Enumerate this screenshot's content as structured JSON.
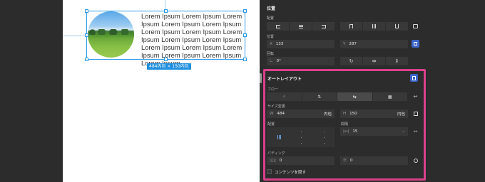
{
  "canvas": {
    "lorem_text": "Lorem Ipsum Lorem Ipsum Lorem Ipsum Lorem Ipsum Lorem Ipsum Lorem Ipsum Lorem Ipsum Lorem Ipsum Lorem Ipsum Lorem Ipsum Lorem Ipsum Lorem Ipsum Lorem Ipsum Lorem Ipsum Lorem Ipsum Lorem Ipsum",
    "size_badge": "484内包 × 150内包"
  },
  "panel": {
    "position_section_title": "位置",
    "alignment_label": "配置",
    "position_label": "位置",
    "x_label": "X",
    "x_value": "133",
    "y_label": "Y",
    "y_value": "287",
    "rotation_label": "回転",
    "rotation_value": "0°"
  },
  "autolayout": {
    "title": "オートレイアウト",
    "flow_label": "フロー",
    "resize_label": "サイズ変更",
    "width_label": "W",
    "width_value": "484",
    "width_mode": "内包",
    "height_label": "H",
    "height_value": "150",
    "height_mode": "内包",
    "alignment_label": "配置",
    "gap_label": "間隔",
    "gap_value": "15",
    "padding_label": "パディング",
    "padding_h_value": "0",
    "padding_v_value": "0",
    "clip_content_label": "コンテンツを隠す"
  },
  "colors": {
    "selection": "#2f9be8",
    "highlight_border": "#d9418b",
    "active_toggle": "#3c64c8",
    "panel_bg": "#2c2c2c"
  },
  "icons": [
    "align-left-icon",
    "align-center-h-icon",
    "align-right-icon",
    "align-top-icon",
    "align-center-v-icon",
    "align-bottom-icon",
    "distribute-icon",
    "flip-rotate-icon",
    "flip-horizontal-icon",
    "flip-vertical-icon",
    "autolayout-icon",
    "flow-none-icon",
    "flow-vertical-icon",
    "flow-horizontal-icon",
    "flow-grid-icon",
    "wrap-icon",
    "resize-icon",
    "gap-settings-icon",
    "padding-individual-icon"
  ]
}
